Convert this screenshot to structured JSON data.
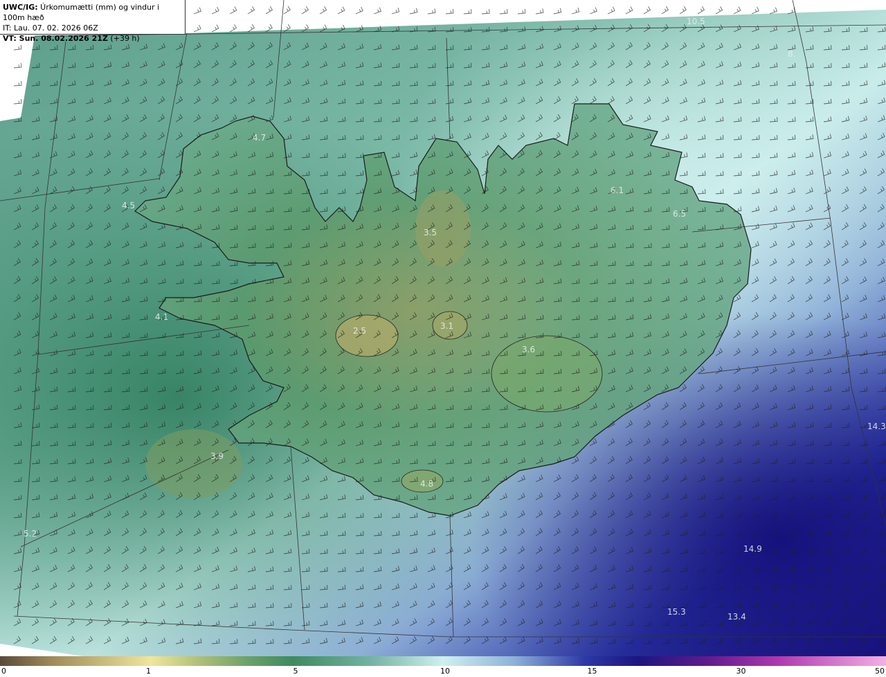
{
  "header": {
    "line1_bold": "UWC/IG:",
    "line1_text": " Úrkomumætti (mm) og vindur i 100m hæð",
    "line2": "IT: Lau. 07. 02. 2026 06Z",
    "line3_bold": "VT: Sun. 08.02.2026 21Z",
    "line3_text": " (+39 h)"
  },
  "colors": {
    "scale": [
      "#6b5840",
      "#a9965c",
      "#f2ea9c",
      "#b4c078",
      "#6fa86a",
      "#3e8a5e",
      "#2f7a5e",
      "#5a9c86",
      "#8fc7bb",
      "#c9ecea",
      "#c6e6f2",
      "#8fb4d8",
      "#5a72c0",
      "#2a32a0",
      "#1a107a",
      "#6a1a8c",
      "#b03ab0",
      "#f0a8e0"
    ],
    "coastline": "#1a1a1a",
    "grid": "#333333"
  },
  "colorbar": {
    "ticks": [
      {
        "label": "0",
        "pos": 0.0
      },
      {
        "label": "1",
        "pos": 0.168
      },
      {
        "label": "5",
        "pos": 0.334
      },
      {
        "label": "10",
        "pos": 0.5
      },
      {
        "label": "15",
        "pos": 0.666
      },
      {
        "label": "30",
        "pos": 0.834
      },
      {
        "label": "50",
        "pos": 1.0
      }
    ]
  },
  "values": [
    {
      "label": "10.5",
      "id": "n1"
    },
    {
      "label": "8.",
      "id": "n2"
    },
    {
      "label": "4.7",
      "id": "v1"
    },
    {
      "label": "4.5",
      "id": "v2"
    },
    {
      "label": "6.1",
      "id": "v3"
    },
    {
      "label": "6.5",
      "id": "v4"
    },
    {
      "label": "3.5",
      "id": "v5"
    },
    {
      "label": "4.1",
      "id": "v6"
    },
    {
      "label": "2.5",
      "id": "v7"
    },
    {
      "label": "3.1",
      "id": "v8"
    },
    {
      "label": "3.6",
      "id": "v9"
    },
    {
      "label": "14.3",
      "id": "v10"
    },
    {
      "label": "3.9",
      "id": "v11"
    },
    {
      "label": "4.8",
      "id": "v12"
    },
    {
      "label": "5.2",
      "id": "v13"
    },
    {
      "label": "14.9",
      "id": "v14"
    },
    {
      "label": "15.3",
      "id": "v15"
    },
    {
      "label": "13.4",
      "id": "v16"
    }
  ]
}
